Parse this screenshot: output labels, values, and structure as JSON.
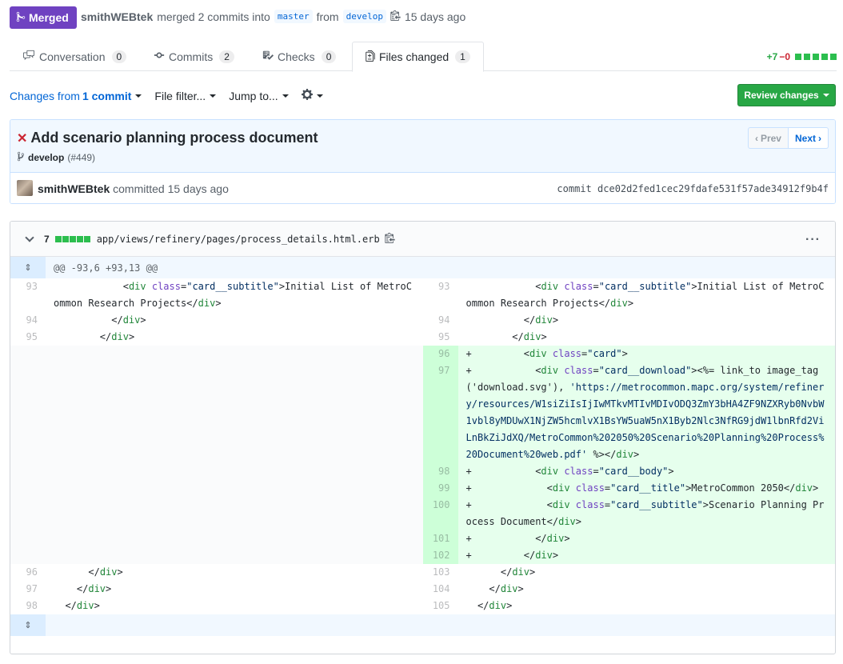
{
  "pr": {
    "state": "Merged",
    "author": "smithWEBtek",
    "action": "merged 2 commits into",
    "base": "master",
    "from_word": "from",
    "head": "develop",
    "time": "15 days ago"
  },
  "tabs": [
    {
      "label": "Conversation",
      "count": "0",
      "icon": "comment-icon"
    },
    {
      "label": "Commits",
      "count": "2",
      "icon": "commit-icon"
    },
    {
      "label": "Checks",
      "count": "0",
      "icon": "checklist-icon"
    },
    {
      "label": "Files changed",
      "count": "1",
      "icon": "file-diff-icon",
      "selected": true
    }
  ],
  "diffstat": {
    "additions": "+7",
    "deletions": "−0"
  },
  "toolbar": {
    "changes_prefix": "Changes from",
    "changes_value": "1 commit",
    "file_filter": "File filter...",
    "jump_to": "Jump to...",
    "review_button": "Review changes"
  },
  "commit": {
    "title": "Add scenario planning process document",
    "branch": "develop",
    "pr_number": "(#449)",
    "prev": "Prev",
    "next": "Next",
    "author": "smithWEBtek",
    "committed": "committed 15 days ago",
    "sha_label": "commit",
    "sha": "dce02d2fed1cec29fdafe531f57ade34912f9b4f"
  },
  "file": {
    "changes": "7",
    "path": "app/views/refinery/pages/process_details.html.erb",
    "hunk": "@@ -93,6 +93,13 @@"
  },
  "colors": {
    "merged": "#6f42c1",
    "added": "#e6ffed",
    "added_num": "#cdffd8",
    "review": "#28a745"
  }
}
